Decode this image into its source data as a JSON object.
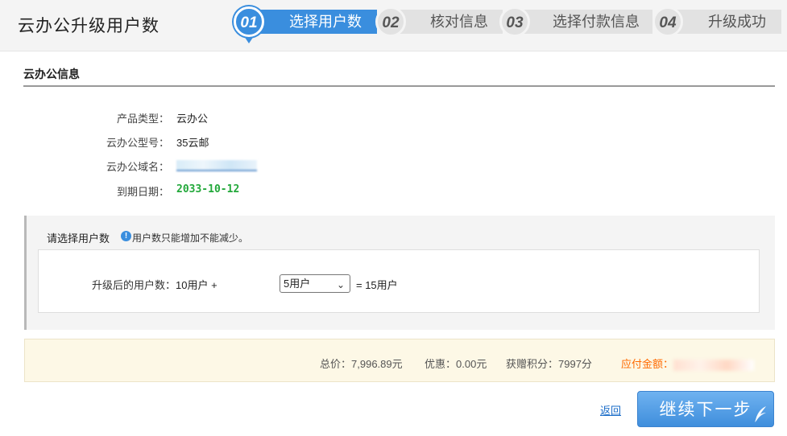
{
  "header": {
    "title": "云办公升级用户数",
    "steps": [
      {
        "num": "01",
        "label": "选择用户数"
      },
      {
        "num": "02",
        "label": "核对信息"
      },
      {
        "num": "03",
        "label": "选择付款信息"
      },
      {
        "num": "04",
        "label": "升级成功"
      }
    ]
  },
  "info": {
    "section_title": "云办公信息",
    "rows": [
      {
        "label": "产品类型：",
        "value": "云办公"
      },
      {
        "label": "云办公型号：",
        "value": "35云邮"
      },
      {
        "label": "云办公域名：",
        "value": ""
      },
      {
        "label": "到期日期：",
        "value": "2033-10-12"
      }
    ]
  },
  "users": {
    "title": "请选择用户数",
    "hint": "用户数只能增加不能减少。",
    "label": "升级后的用户数：",
    "base": "10用户 +",
    "selected": "5用户",
    "result": "= 15用户"
  },
  "price": {
    "total_label": "总价：",
    "total_value": "7,996.89元",
    "discount_label": "优惠：",
    "discount_value": "0.00元",
    "points_label": "获赠积分：",
    "points_value": "7997分",
    "pay_label": "应付金额："
  },
  "actions": {
    "back": "返回",
    "next": "继续下一步"
  },
  "colors": {
    "accent": "#3a8ede",
    "date_green": "#22a83a",
    "pay_orange": "#ff6a00"
  }
}
